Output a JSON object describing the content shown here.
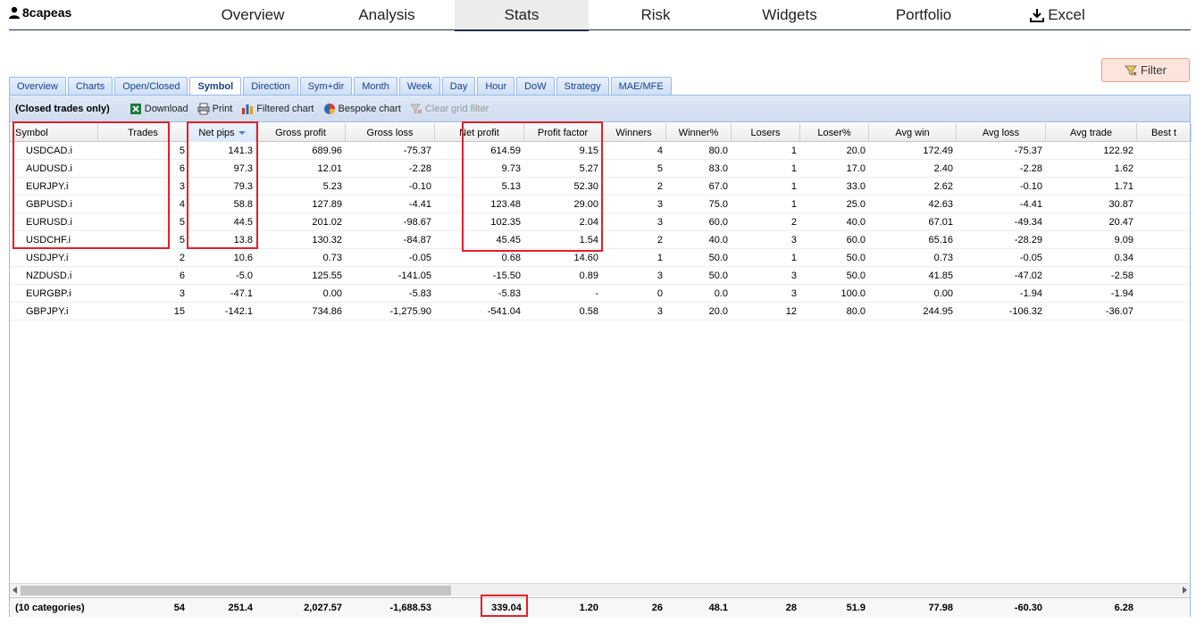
{
  "nav": {
    "user": "8capeas",
    "items": [
      "Overview",
      "Analysis",
      "Stats",
      "Risk",
      "Widgets",
      "Portfolio",
      "Excel"
    ],
    "active": "Stats"
  },
  "filter_button": "Filter",
  "tabs": [
    "Overview",
    "Charts",
    "Open/Closed",
    "Symbol",
    "Direction",
    "Sym+dir",
    "Month",
    "Week",
    "Day",
    "Hour",
    "DoW",
    "Strategy",
    "MAE/MFE"
  ],
  "active_tab": "Symbol",
  "toolbar": {
    "label": "(Closed trades only)",
    "download": "Download",
    "print": "Print",
    "filtered_chart": "Filtered chart",
    "bespoke_chart": "Bespoke chart",
    "clear_filter": "Clear grid filter"
  },
  "columns": [
    "Symbol",
    "Trades",
    "Net pips",
    "Gross profit",
    "Gross loss",
    "Net profit",
    "Profit factor",
    "Winners",
    "Winner%",
    "Losers",
    "Loser%",
    "Avg win",
    "Avg loss",
    "Avg trade",
    "Best t"
  ],
  "rows": [
    [
      "USDCAD.i",
      "5",
      "141.3",
      "689.96",
      "-75.37",
      "614.59",
      "9.15",
      "4",
      "80.0",
      "1",
      "20.0",
      "172.49",
      "-75.37",
      "122.92"
    ],
    [
      "AUDUSD.i",
      "6",
      "97.3",
      "12.01",
      "-2.28",
      "9.73",
      "5.27",
      "5",
      "83.0",
      "1",
      "17.0",
      "2.40",
      "-2.28",
      "1.62"
    ],
    [
      "EURJPY.i",
      "3",
      "79.3",
      "5.23",
      "-0.10",
      "5.13",
      "52.30",
      "2",
      "67.0",
      "1",
      "33.0",
      "2.62",
      "-0.10",
      "1.71"
    ],
    [
      "GBPUSD.i",
      "4",
      "58.8",
      "127.89",
      "-4.41",
      "123.48",
      "29.00",
      "3",
      "75.0",
      "1",
      "25.0",
      "42.63",
      "-4.41",
      "30.87"
    ],
    [
      "EURUSD.i",
      "5",
      "44.5",
      "201.02",
      "-98.67",
      "102.35",
      "2.04",
      "3",
      "60.0",
      "2",
      "40.0",
      "67.01",
      "-49.34",
      "20.47"
    ],
    [
      "USDCHF.i",
      "5",
      "13.8",
      "130.32",
      "-84.87",
      "45.45",
      "1.54",
      "2",
      "40.0",
      "3",
      "60.0",
      "65.16",
      "-28.29",
      "9.09"
    ],
    [
      "USDJPY.i",
      "2",
      "10.6",
      "0.73",
      "-0.05",
      "0.68",
      "14.60",
      "1",
      "50.0",
      "1",
      "50.0",
      "0.73",
      "-0.05",
      "0.34"
    ],
    [
      "NZDUSD.i",
      "6",
      "-5.0",
      "125.55",
      "-141.05",
      "-15.50",
      "0.89",
      "3",
      "50.0",
      "3",
      "50.0",
      "41.85",
      "-47.02",
      "-2.58"
    ],
    [
      "EURGBP.i",
      "3",
      "-47.1",
      "0.00",
      "-5.83",
      "-5.83",
      "-",
      "0",
      "0.0",
      "3",
      "100.0",
      "0.00",
      "-1.94",
      "-1.94"
    ],
    [
      "GBPJPY.i",
      "15",
      "-142.1",
      "734.86",
      "-1,275.90",
      "-541.04",
      "0.58",
      "3",
      "20.0",
      "12",
      "80.0",
      "244.95",
      "-106.32",
      "-36.07"
    ]
  ],
  "summary": [
    "(10 categories)",
    "54",
    "251.4",
    "2,027.57",
    "-1,688.53",
    "339.04",
    "1.20",
    "26",
    "48.1",
    "28",
    "51.9",
    "77.98",
    "-60.30",
    "6.28"
  ],
  "colors": {
    "highlight": "#e0202a",
    "tab_text": "#15428b",
    "panel_border": "#99bbe8"
  }
}
